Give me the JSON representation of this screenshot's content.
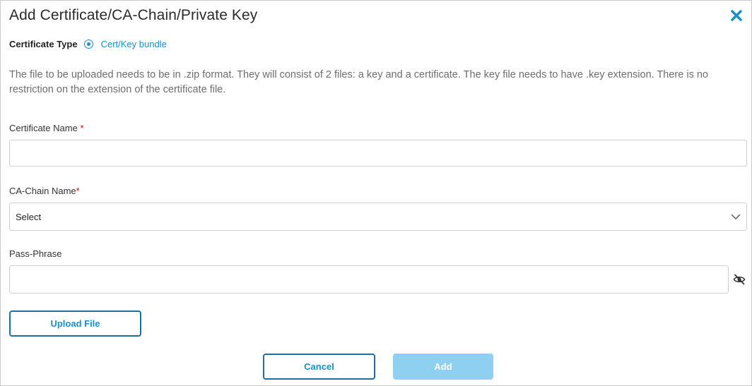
{
  "dialog": {
    "title": "Add Certificate/CA-Chain/Private Key"
  },
  "certificate_type": {
    "label": "Certificate Type",
    "selected_option": "Cert/Key bundle"
  },
  "help_text": "The file to be uploaded needs to be in .zip format. They will consist of 2 files: a key and a certificate. The key file needs to have .key extension. There is no restriction on the extension of the certificate file.",
  "fields": {
    "certificate_name": {
      "label": "Certificate Name",
      "required_mark": "*",
      "value": ""
    },
    "ca_chain_name": {
      "label": "CA-Chain Name",
      "required_mark": "*",
      "selected": "Select"
    },
    "pass_phrase": {
      "label": "Pass-Phrase",
      "value": ""
    }
  },
  "buttons": {
    "upload": "Upload File",
    "cancel": "Cancel",
    "add": "Add"
  },
  "icons": {
    "close": "close-icon",
    "radio": "radio-selected-icon",
    "dropdown": "chevron-down-icon",
    "visibility": "eye-slash-icon"
  },
  "colors": {
    "accent": "#1a8fc9",
    "required": "#d0021b",
    "disabled_button": "#8fd0f0",
    "outline_border": "#1a6fa3"
  }
}
